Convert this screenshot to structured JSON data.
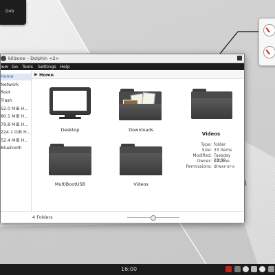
{
  "desktop": {
    "widget_label": "Gob",
    "clock": "16:00"
  },
  "window": {
    "title": "killzone – Dolphin <2>",
    "menu": [
      "iew",
      "Go",
      "Tools",
      "Settings",
      "Help"
    ],
    "sidebar": [
      "Home",
      "Network",
      "Root",
      "Trash",
      "52.0 MiB H...",
      "80.1 MiB H...",
      "79.8 MiB H...",
      "224.1 GiB H...",
      "52.4 MiB H...",
      "Bluetooth"
    ],
    "location": "Home",
    "items": [
      {
        "name": "Desktop",
        "icon": "monitor-icon"
      },
      {
        "name": "Downloads",
        "icon": "folder-downloads-icon"
      },
      {
        "name": "MultiBootUSB",
        "icon": "folder-icon"
      },
      {
        "name": "Videos",
        "icon": "folder-icon"
      }
    ],
    "info": {
      "title": "Videos",
      "rows": [
        {
          "key": "Type:",
          "value": "folder"
        },
        {
          "key": "Size:",
          "value": "33 items"
        },
        {
          "key": "Modified:",
          "value": "Tuesday 23:39"
        },
        {
          "key": "Owner:",
          "value": "killzone"
        },
        {
          "key": "Permissions:",
          "value": "drwxr-xr-x"
        }
      ]
    },
    "status": "4 Folders",
    "zoom_level": 0.5
  },
  "colors": {
    "menubar": "#1c1c1c",
    "selection": "#dfe8f2",
    "panel": "#1b1b1b",
    "accent_red": "#c22222"
  }
}
